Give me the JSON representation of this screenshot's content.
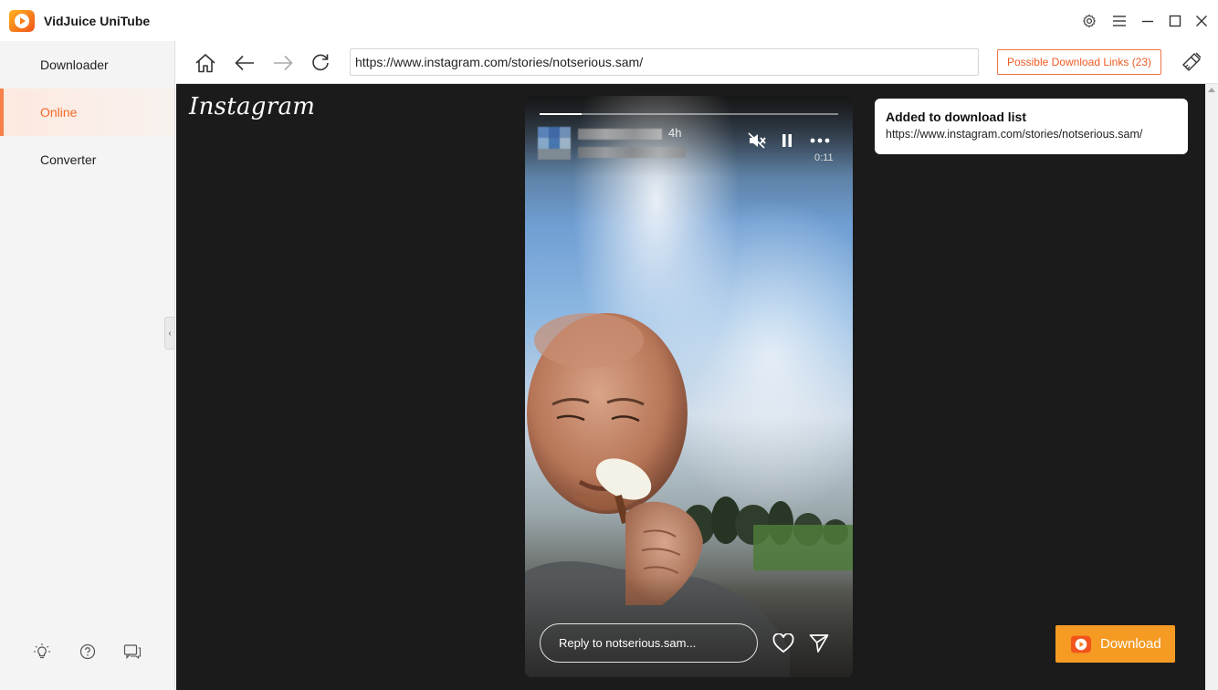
{
  "app": {
    "title": "VidJuice UniTube",
    "brand_color": "#f5801f",
    "accent_color": "#f06a2a"
  },
  "window_controls": [
    "gear-icon",
    "menu-icon",
    "minimize-icon",
    "maximize-icon",
    "close-icon"
  ],
  "sidebar": {
    "items": [
      {
        "label": "Downloader",
        "active": false
      },
      {
        "label": "Online",
        "active": true
      },
      {
        "label": "Converter",
        "active": false
      }
    ],
    "bottom_icons": [
      "lightbulb-icon",
      "help-icon",
      "feedback-icon"
    ]
  },
  "toolbar": {
    "url": "https://www.instagram.com/stories/notserious.sam/",
    "possible_links_label": "Possible Download Links (23)"
  },
  "webpage": {
    "site_logo": "Instagram",
    "story": {
      "time_ago": "4h",
      "duration": "0:11",
      "progress": 0.14,
      "reply_placeholder": "Reply to notserious.sam..."
    }
  },
  "toast": {
    "title": "Added to download list",
    "url": "https://www.instagram.com/stories/notserious.sam/"
  },
  "download_button": {
    "label": "Download",
    "color": "#f59a23"
  }
}
